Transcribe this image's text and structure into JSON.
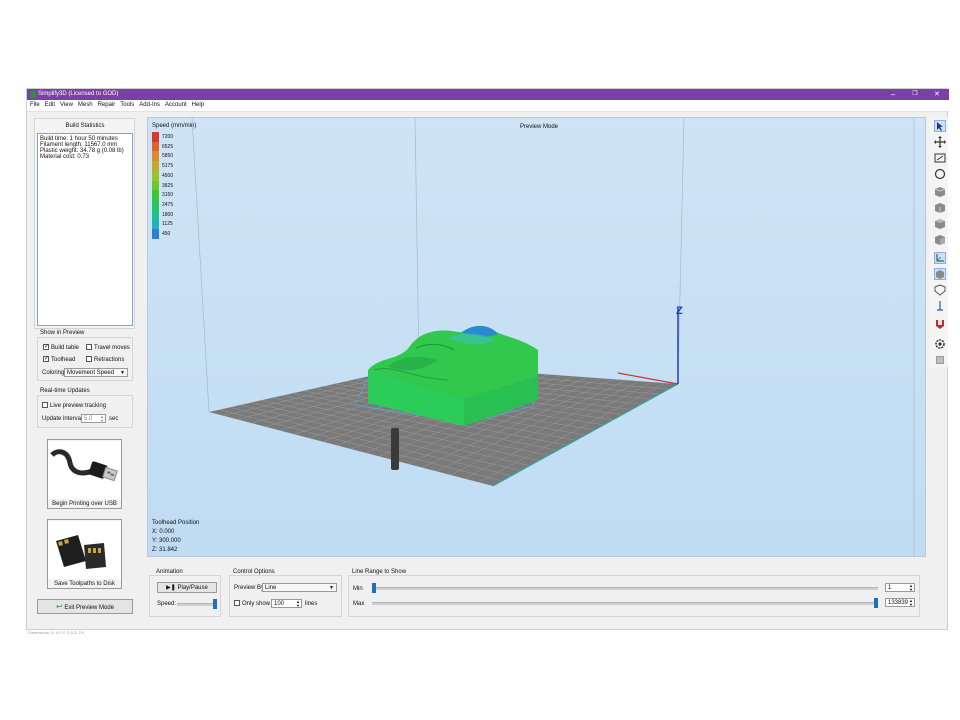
{
  "window": {
    "title": "Simplify3D (Licensed to GOD)",
    "minimize": "–",
    "restore": "❐",
    "close": "✕"
  },
  "menu": [
    "File",
    "Edit",
    "View",
    "Mesh",
    "Repair",
    "Tools",
    "Add-Ins",
    "Account",
    "Help"
  ],
  "build_statistics": {
    "title": "Build Statistics",
    "lines": [
      "Build time: 1 hour 50 minutes",
      "Filament length: 11567.0 mm",
      "Plastic weight: 34.78 g (0.08 lb)",
      "Material cost: 0.73"
    ]
  },
  "show_in_preview": {
    "title": "Show in Preview",
    "build_table": "Build table",
    "build_table_checked": true,
    "travel_moves": "Travel moves",
    "travel_moves_checked": false,
    "toolhead": "Toolhead",
    "toolhead_checked": true,
    "retractions": "Retractions",
    "retractions_checked": false,
    "coloring_label": "Coloring",
    "coloring_value": "Movement Speed"
  },
  "realtime": {
    "title": "Real-time Updates",
    "live_preview": "Live preview tracking",
    "live_preview_checked": false,
    "update_interval_label": "Update interval",
    "update_interval_value": "5.0",
    "update_interval_unit": "sec"
  },
  "buttons": {
    "usb": "Begin Printing over USB",
    "sd": "Save Toolpaths to Disk",
    "exit": "Exit Preview Mode",
    "play": "Play/Pause"
  },
  "viewport": {
    "mode": "Preview Mode",
    "legend_title": "Speed (mm/min)",
    "legend": [
      {
        "value": "7200",
        "color": "#d8392b"
      },
      {
        "value": "6525",
        "color": "#e0612c"
      },
      {
        "value": "5850",
        "color": "#e08a2e"
      },
      {
        "value": "5175",
        "color": "#c6a82c"
      },
      {
        "value": "4500",
        "color": "#9cc42a"
      },
      {
        "value": "3825",
        "color": "#6ec829"
      },
      {
        "value": "3150",
        "color": "#3fc62f"
      },
      {
        "value": "2475",
        "color": "#27c55c"
      },
      {
        "value": "1800",
        "color": "#1fc28f"
      },
      {
        "value": "1125",
        "color": "#1cb4bd"
      },
      {
        "value": "450",
        "color": "#2a7fd0"
      }
    ],
    "axis_label": "Z",
    "toolhead": {
      "title": "Toolhead Position",
      "x": "X: 0.000",
      "y": "Y: 300.000",
      "z": "Z: 31.842"
    }
  },
  "animation": {
    "title": "Animation",
    "speed_label": "Speed:",
    "speed_fraction": 1.0
  },
  "control_options": {
    "title": "Control Options",
    "preview_by_label": "Preview By",
    "preview_by_value": "Line",
    "only_show_label": "Only show",
    "only_show_checked": false,
    "only_show_value": "100",
    "only_show_unit": "lines"
  },
  "line_range": {
    "title": "Line Range to Show",
    "min_label": "Min",
    "min_value": "1",
    "min_fraction": 0.0,
    "max_label": "Max",
    "max_value": "133839",
    "max_fraction": 1.0
  },
  "status_bar": "Dimensions: X: 0.0 Y: 0.0 Z: 2.0"
}
